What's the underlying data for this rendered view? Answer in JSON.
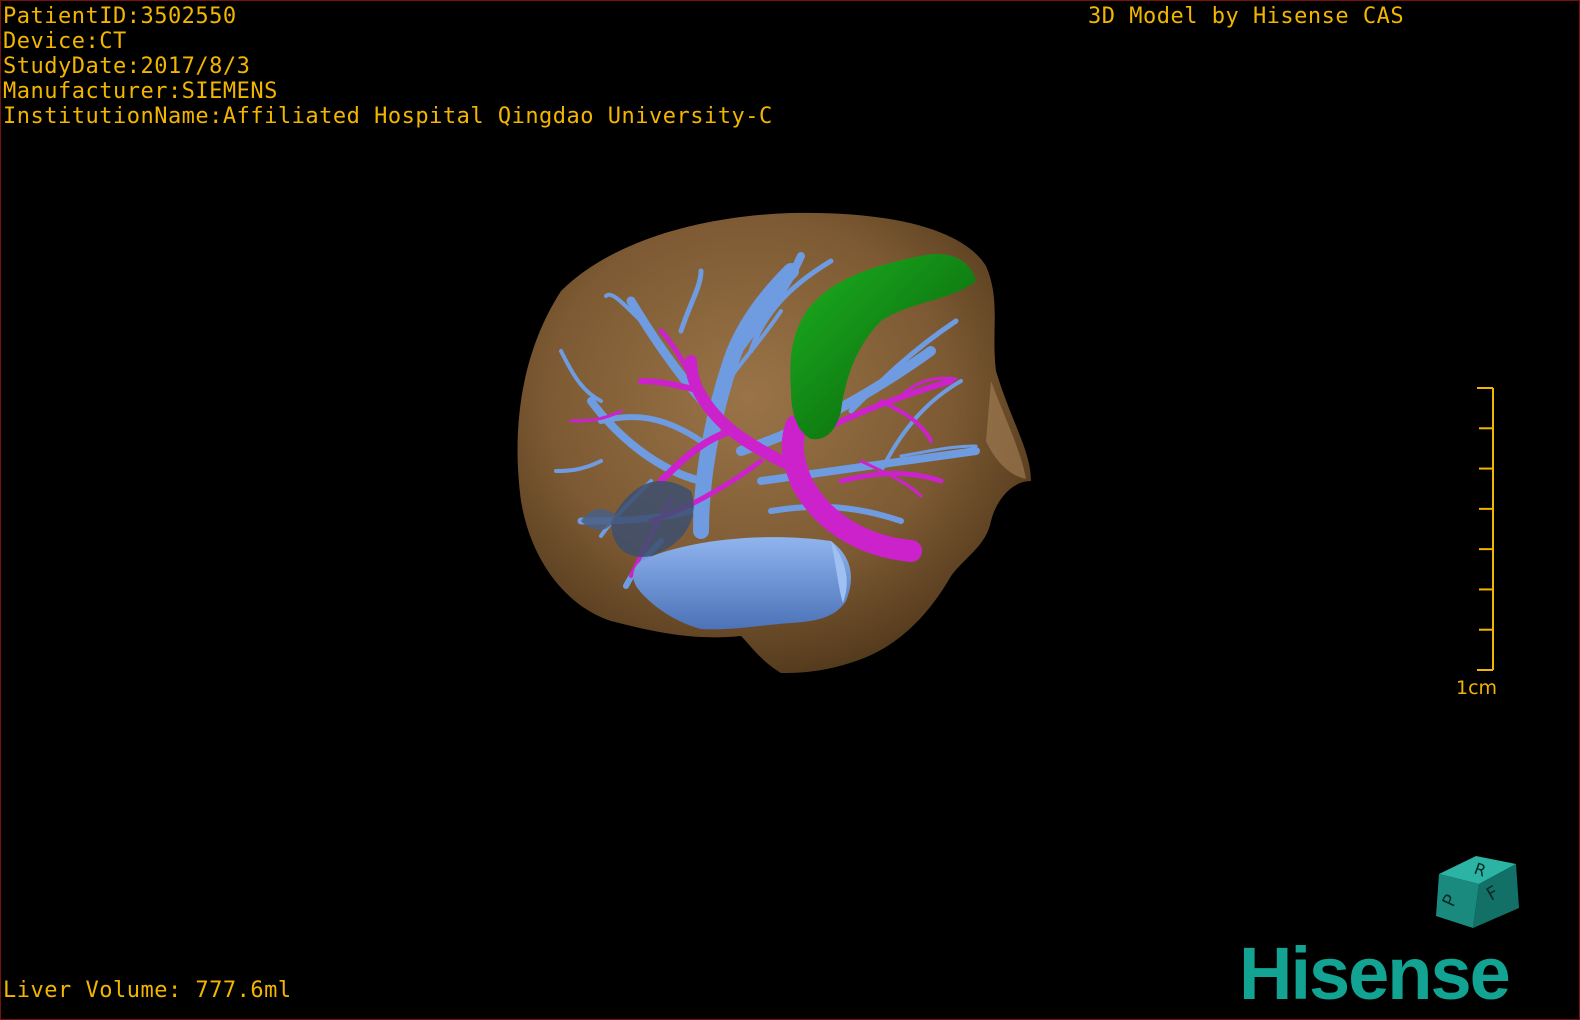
{
  "window": {
    "background": "#000000",
    "border_color": "#7a1010",
    "overlay_color": "#f2b500"
  },
  "dicom_info": {
    "patient_id": "PatientID:3502550",
    "device": "Device:CT",
    "study_date": "StudyDate:2017/8/3",
    "manufacturer": "Manufacturer:SIEMENS",
    "institution": "InstitutionName:Affiliated Hospital Qingdao University-C"
  },
  "watermark_title": "3D Model by Hisense CAS",
  "scale": {
    "label": "1cm",
    "ticks": 8
  },
  "liver_volume": "Liver Volume: 777.6ml",
  "orientation_cube": {
    "faces": [
      "R",
      "F",
      "P"
    ],
    "color": "#1a8a7e"
  },
  "brand": {
    "name": "Hisense",
    "color": "#12a392"
  },
  "model_colors": {
    "liver": "#7d5a33",
    "portal_vein": "#6f9be0",
    "hepatic_vein": "#cc22cc",
    "gallbladder": "#0d7a12",
    "ivc": "#6e97da"
  },
  "icons": [
    "liver-model",
    "orientation-cube-icon",
    "hisense-logo",
    "scale-bar"
  ]
}
